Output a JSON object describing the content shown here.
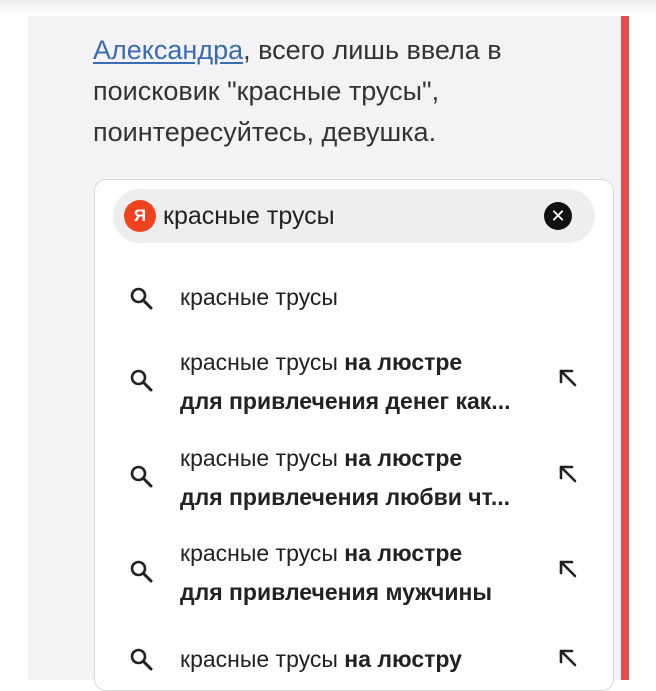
{
  "comment": {
    "author_link": "Александра",
    "text": ", всего лишь ввела в поисковик \"красные трусы\", поинтересуйтесь, девушка."
  },
  "search": {
    "logo_letter": "Я",
    "query": "красные трусы",
    "clear_icon": "clear-icon"
  },
  "suggestions": [
    {
      "normal": "красные трусы",
      "bold": "",
      "line2": ""
    },
    {
      "normal": "красные трусы ",
      "bold": "на люстре",
      "line2": "для привлечения денег как..."
    },
    {
      "normal": "красные трусы ",
      "bold": "на люстре",
      "line2": "для привлечения любви чт..."
    },
    {
      "normal": "красные трусы ",
      "bold": "на люстре",
      "line2": "для привлечения мужчины"
    },
    {
      "normal": "красные трусы ",
      "bold": "на люстру",
      "line2": ""
    }
  ],
  "colors": {
    "accent_bar": "#e94c4f",
    "link": "#3b6cb3",
    "yandex_logo": "#f1421f"
  }
}
